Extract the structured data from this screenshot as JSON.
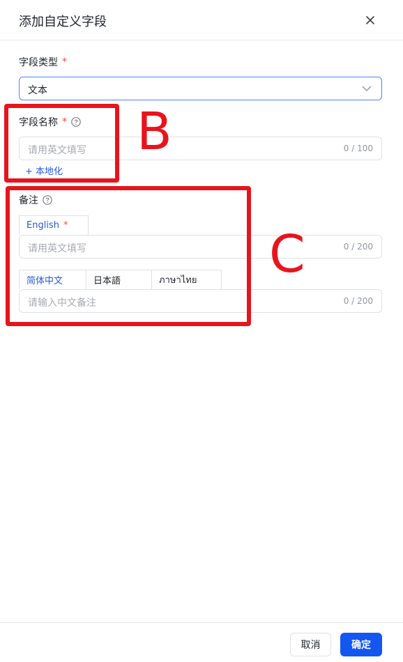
{
  "dialog": {
    "title": "添加自定义字段"
  },
  "field_type": {
    "label": "字段类型",
    "required_mark": "*",
    "value": "文本"
  },
  "field_name": {
    "label": "字段名称",
    "required_mark": "*",
    "placeholder": "请用英文填写",
    "counter": "0 / 100",
    "localize_link": "+ 本地化"
  },
  "remark": {
    "label": "备注",
    "english_tab": "English",
    "english_required_mark": "*",
    "english_placeholder": "请用英文填写",
    "english_counter": "0 / 200",
    "locale_tabs": [
      "简体中文",
      "日本語",
      "ภาษาไทย"
    ],
    "locale_placeholder": "请输入中文备注",
    "locale_counter": "0 / 200"
  },
  "annotations": {
    "b_letter": "B",
    "c_letter": "C",
    "color": "#e8141c"
  },
  "footer": {
    "cancel_label": "取消",
    "ok_label": "确定"
  },
  "colors": {
    "accent": "#1456f0",
    "link": "#245bdb",
    "required": "#f54a45"
  },
  "icons": {
    "close": "close-icon",
    "help": "help-circle-icon",
    "select": "chevron-down-icon"
  }
}
